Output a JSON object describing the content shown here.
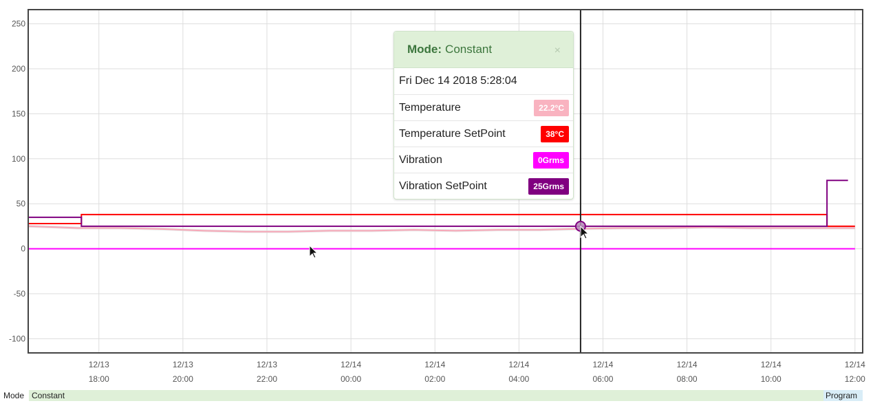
{
  "chart_data": {
    "type": "line",
    "title": "",
    "xlabel": "",
    "ylabel": "",
    "ylim": [
      -115,
      265
    ],
    "xlim": [
      "2018-12-13 16:20",
      "2018-12-14 12:10"
    ],
    "grid": true,
    "y_ticks": [
      250,
      200,
      150,
      100,
      50,
      0,
      -50,
      -100
    ],
    "x_ticks": [
      {
        "date": "12/13",
        "time": "18:00",
        "at": "2018-12-13 18:00"
      },
      {
        "date": "12/13",
        "time": "20:00",
        "at": "2018-12-13 20:00"
      },
      {
        "date": "12/13",
        "time": "22:00",
        "at": "2018-12-13 22:00"
      },
      {
        "date": "12/14",
        "time": "00:00",
        "at": "2018-12-14 00:00"
      },
      {
        "date": "12/14",
        "time": "02:00",
        "at": "2018-12-14 02:00"
      },
      {
        "date": "12/14",
        "time": "04:00",
        "at": "2018-12-14 04:00"
      },
      {
        "date": "12/14",
        "time": "06:00",
        "at": "2018-12-14 06:00"
      },
      {
        "date": "12/14",
        "time": "08:00",
        "at": "2018-12-14 08:00"
      },
      {
        "date": "12/14",
        "time": "10:00",
        "at": "2018-12-14 10:00"
      },
      {
        "date": "12/14",
        "time": "12:00",
        "at": "2018-12-14 12:00"
      }
    ],
    "series": [
      {
        "name": "Temperature",
        "color": "#f7a8b8",
        "step": false,
        "x": [
          "2018-12-13 16:20",
          "2018-12-13 17:00",
          "2018-12-13 17:30",
          "2018-12-13 18:30",
          "2018-12-13 19:30",
          "2018-12-13 20:30",
          "2018-12-13 21:30",
          "2018-12-13 22:30",
          "2018-12-13 23:30",
          "2018-12-14 00:30",
          "2018-12-14 01:30",
          "2018-12-14 02:30",
          "2018-12-14 03:30",
          "2018-12-14 04:30",
          "2018-12-14 05:28",
          "2018-12-14 06:30",
          "2018-12-14 07:30",
          "2018-12-14 08:30",
          "2018-12-14 09:30",
          "2018-12-14 10:30",
          "2018-12-14 11:30",
          "2018-12-14 12:00"
        ],
        "y": [
          25,
          24,
          23,
          23,
          22,
          20,
          19,
          19,
          20,
          20,
          21,
          20,
          21,
          21,
          22.2,
          23,
          23,
          24,
          23,
          23,
          23,
          23
        ]
      },
      {
        "name": "Temperature SetPoint",
        "color": "#ff0000",
        "step": true,
        "x": [
          "2018-12-13 16:20",
          "2018-12-13 17:35",
          "2018-12-14 11:20",
          "2018-12-14 12:00"
        ],
        "y": [
          28,
          38,
          25,
          25
        ]
      },
      {
        "name": "Vibration",
        "color": "#ff00ff",
        "step": true,
        "x": [
          "2018-12-13 16:20",
          "2018-12-14 12:00"
        ],
        "y": [
          0,
          0
        ]
      },
      {
        "name": "Vibration SetPoint",
        "color": "#800080",
        "step": true,
        "x": [
          "2018-12-13 16:20",
          "2018-12-13 17:35",
          "2018-12-14 11:20",
          "2018-12-14 11:50"
        ],
        "y": [
          35,
          25,
          76,
          76
        ]
      }
    ],
    "cursor": {
      "x": "2018-12-14 05:28",
      "y": 25
    }
  },
  "tooltip": {
    "mode_label": "Mode:",
    "mode_value": "Constant",
    "close": "×",
    "datetime": "Fri Dec 14 2018 5:28:04",
    "rows": [
      {
        "label": "Temperature",
        "value": "22.2°C",
        "color": "#f9b3c0"
      },
      {
        "label": "Temperature SetPoint",
        "value": "38°C",
        "color": "#ff0000"
      },
      {
        "label": "Vibration",
        "value": "0Grms",
        "color": "#ff00ff"
      },
      {
        "label": "Vibration SetPoint",
        "value": "25Grms",
        "color": "#800080"
      }
    ]
  },
  "mode_bar": {
    "label": "Mode",
    "segments": [
      {
        "label": "Constant",
        "color": "#dff0d8"
      },
      {
        "label": "Program",
        "color": "#d9edf7"
      }
    ]
  }
}
